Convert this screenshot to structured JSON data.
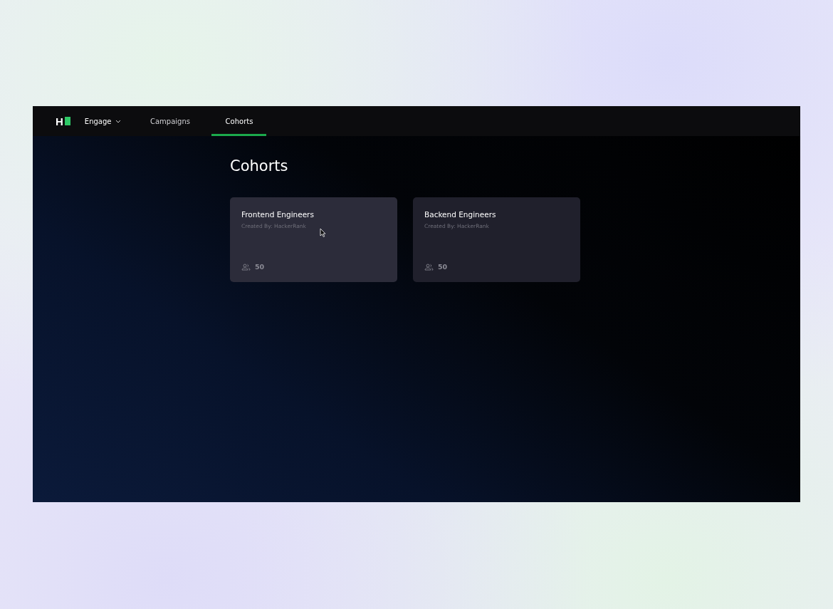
{
  "nav": {
    "logo": "H",
    "product": "Engage",
    "tabs": [
      {
        "label": "Campaigns",
        "selected": false
      },
      {
        "label": "Cohorts",
        "selected": true
      }
    ]
  },
  "page": {
    "title": "Cohorts"
  },
  "cohorts": [
    {
      "name": "Frontend Engineers",
      "created_by": "Created By: HackerRank",
      "members": "50",
      "hovered": true
    },
    {
      "name": "Backend Engineers",
      "created_by": "Created By: HackerRank",
      "members": "50",
      "hovered": false
    }
  ]
}
